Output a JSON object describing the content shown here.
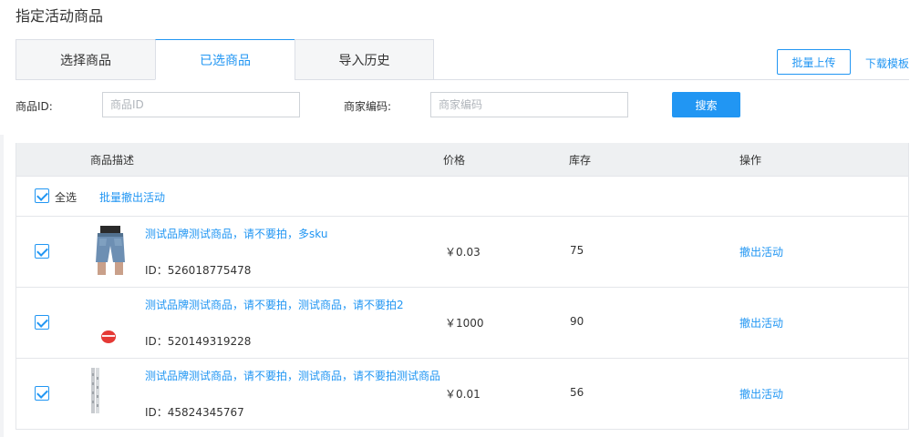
{
  "page_title": "指定活动商品",
  "tabs": [
    {
      "label": "选择商品",
      "active": false
    },
    {
      "label": "已选商品",
      "active": true
    },
    {
      "label": "导入历史",
      "active": false
    }
  ],
  "actions": {
    "bulk_upload": "批量上传",
    "download_template": "下载模板"
  },
  "filters": {
    "product_id_label": "商品ID:",
    "product_id_placeholder": "商品ID",
    "merchant_code_label": "商家编码:",
    "merchant_code_placeholder": "商家编码",
    "search_button": "搜索"
  },
  "table": {
    "headers": {
      "description": "商品描述",
      "price": "价格",
      "stock": "库存",
      "operation": "操作"
    },
    "select_all_label": "全选",
    "bulk_withdraw": "批量撤出活动",
    "rows": [
      {
        "title": "测试品牌测试商品，请不要拍，多sku",
        "id": "ID：526018775478",
        "price": "￥0.03",
        "stock": "75",
        "action": "撤出活动",
        "checked": true,
        "thumb_icon": "denim-shorts-image"
      },
      {
        "title": "测试品牌测试商品，请不要拍，测试商品，请不要拍2",
        "id": "ID：520149319228",
        "price": "￥1000",
        "stock": "90",
        "action": "撤出活动",
        "checked": true,
        "thumb_icon": "red-badge-image"
      },
      {
        "title": "测试品牌测试商品，请不要拍，测试商品，请不要拍测试商品",
        "id": "ID：45824345767",
        "price": "￥0.01",
        "stock": "56",
        "action": "撤出活动",
        "checked": true,
        "thumb_icon": "gray-strips-image"
      }
    ]
  },
  "colors": {
    "accent": "#2196f3",
    "header_bg": "#eef0f2",
    "border": "#e4e6ea"
  }
}
